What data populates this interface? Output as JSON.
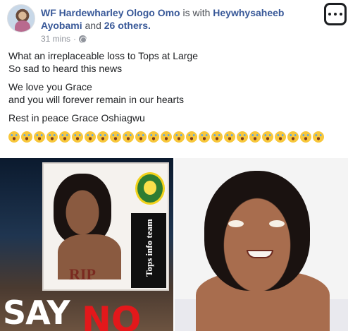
{
  "post": {
    "author": "WF Hardewharley Ologo Omo",
    "with_text": "is with",
    "tagged": "Heywhysaheeb Ayobami",
    "and_text": "and",
    "others": "26 others.",
    "time": "31 mins",
    "dot": "·",
    "privacy_icon": "globe-icon",
    "more_icon": "ellipsis-icon",
    "lines": [
      "What an irreplaceable loss to Tops at Large",
      "So sad to heard this news",
      "We love you Grace",
      "and you will forever remain in our hearts",
      "Rest in peace Grace Oshiagwu"
    ],
    "emoji_name": "loudly-crying-face",
    "emoji_count": 25
  },
  "photo_left": {
    "card_text": "RIP",
    "side_text": "Tops info team",
    "bottom_white": "SAY",
    "bottom_red": "NO"
  },
  "colors": {
    "link": "#385898",
    "text": "#1c1e21",
    "meta": "#90949c",
    "red_text": "#e3181b"
  }
}
